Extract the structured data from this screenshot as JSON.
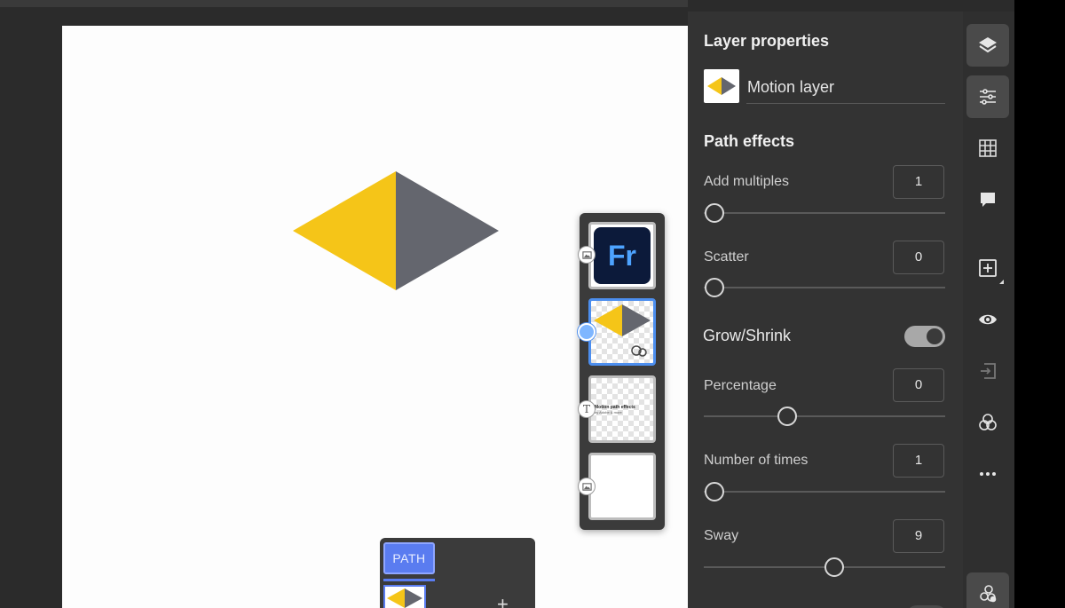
{
  "panel": {
    "title": "Layer properties",
    "layer_name": "Motion layer",
    "section_title": "Path effects"
  },
  "controls": {
    "add_multiples": {
      "label": "Add multiples",
      "value": "1"
    },
    "scatter": {
      "label": "Scatter",
      "value": "0"
    },
    "grow_shrink": {
      "label": "Grow/Shrink",
      "enabled": true
    },
    "percentage": {
      "label": "Percentage",
      "value": "0"
    },
    "number_of_times": {
      "label": "Number of times",
      "value": "1"
    },
    "sway": {
      "label": "Sway",
      "value": "9"
    }
  },
  "layers": {
    "fr_logo_text": "Fr",
    "text_layer_title": "Motion path effects",
    "text_layer_sub": "by Adobe & more"
  },
  "path_panel": {
    "chip_label": "PATH"
  },
  "tools": [
    "layers-icon",
    "properties-icon",
    "grid-icon",
    "comment-icon",
    "add-layer-icon",
    "visibility-icon",
    "import-icon",
    "blend-icon",
    "more-icon",
    "motion-path-icon"
  ],
  "colors": {
    "accent_yellow": "#f5c518",
    "accent_gray": "#64666e",
    "selection_blue": "#4c8eee",
    "path_blue": "#5a7cf0"
  }
}
